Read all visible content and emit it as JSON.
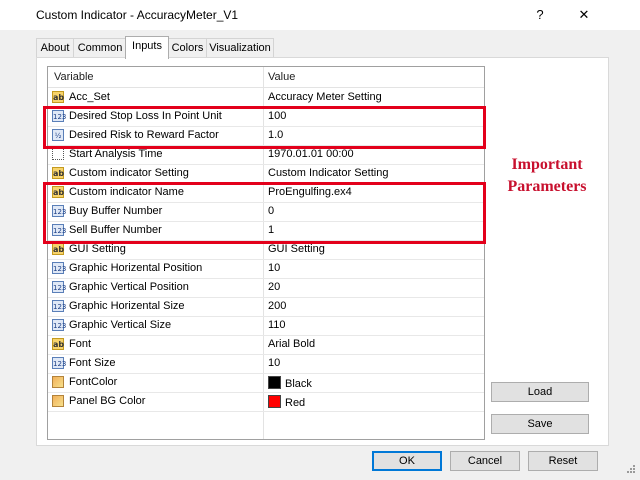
{
  "window": {
    "title": "Custom Indicator - AccuracyMeter_V1",
    "help_glyph": "?",
    "close_glyph": "✕"
  },
  "tabs": [
    "About",
    "Common",
    "Inputs",
    "Colors",
    "Visualization"
  ],
  "active_tab": "Inputs",
  "grid": {
    "headers": {
      "variable": "Variable",
      "value": "Value"
    },
    "rows": [
      {
        "icon": "ab-icon",
        "name": "Acc_Set",
        "value": "Accuracy Meter Setting"
      },
      {
        "icon": "num-icon",
        "name": "Desired Stop Loss In Point Unit",
        "value": "100"
      },
      {
        "icon": "fraction-icon",
        "name": "Desired Risk to Reward Factor",
        "value": "1.0"
      },
      {
        "icon": "clock-icon",
        "name": "Start Analysis Time",
        "value": "1970.01.01 00:00"
      },
      {
        "icon": "ab-icon",
        "name": "Custom indicator Setting",
        "value": "Custom Indicator Setting"
      },
      {
        "icon": "ab-icon",
        "name": "Custom indicator Name",
        "value": "ProEngulfing.ex4"
      },
      {
        "icon": "num-icon",
        "name": "Buy Buffer Number",
        "value": "0"
      },
      {
        "icon": "num-icon",
        "name": "Sell Buffer Number",
        "value": "1"
      },
      {
        "icon": "ab-icon",
        "name": "GUI Setting",
        "value": "GUI Setting"
      },
      {
        "icon": "num-icon",
        "name": "Graphic Horizental Position",
        "value": "10"
      },
      {
        "icon": "num-icon",
        "name": "Graphic Vertical Position",
        "value": "20"
      },
      {
        "icon": "num-icon",
        "name": "Graphic Horizental Size",
        "value": "200"
      },
      {
        "icon": "num-icon",
        "name": "Graphic Vertical Size",
        "value": "110"
      },
      {
        "icon": "ab-icon",
        "name": "Font",
        "value": "Arial Bold"
      },
      {
        "icon": "num-icon",
        "name": "Font Size",
        "value": "10"
      },
      {
        "icon": "color-icon",
        "name": "FontColor",
        "value": "Black",
        "swatch": "#000000"
      },
      {
        "icon": "color-icon",
        "name": "Panel BG Color",
        "value": "Red",
        "swatch": "#ff0000"
      }
    ]
  },
  "side_buttons": {
    "load": "Load",
    "save": "Save"
  },
  "bottom_buttons": {
    "ok": "OK",
    "cancel": "Cancel",
    "reset": "Reset"
  },
  "annotation": {
    "line1": "Important",
    "line2": "Parameters",
    "color": "#c8102e"
  },
  "icon_glyphs": {
    "ab-icon": "ab",
    "num-icon": "123",
    "fraction-icon": "½",
    "clock-icon": "",
    "color-icon": ""
  }
}
